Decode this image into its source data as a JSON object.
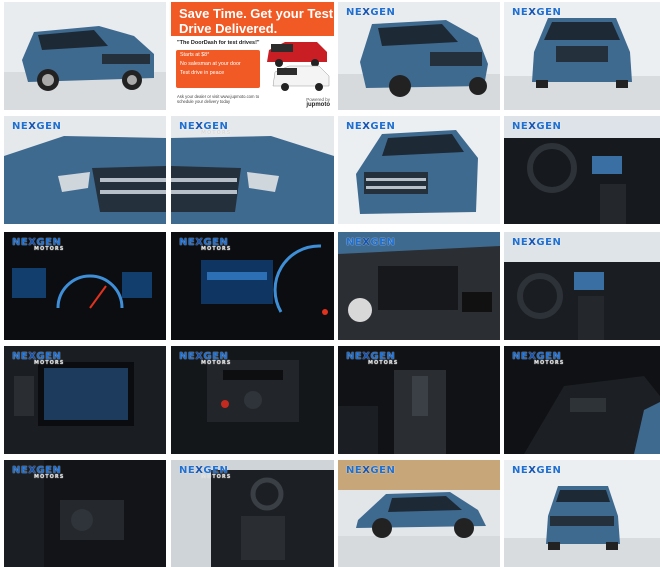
{
  "gallery": {
    "logo_text": "NE",
    "logo_x": "X",
    "logo_end": "GEN",
    "logo_sub": "MOTORS"
  },
  "ad": {
    "title": "Save Time. Get your Test Drive Delivered.",
    "tagline": "\"The DoorDash for test drives!\"",
    "bullets": [
      "Starts at $8*",
      "No salesman at your door",
      "Test drive in peace"
    ],
    "footer": "Ask your dealer or visit www.jupmoto.com to schedule your delivery today",
    "powered_by": "Powered by",
    "brand": "jupmoto"
  },
  "colors": {
    "car_blue": "#3f6a90",
    "studio_bg": "#e9ecef",
    "interior_dark": "#111418",
    "ad_orange": "#f15a24",
    "logo_blue": "#1f6fd1"
  }
}
